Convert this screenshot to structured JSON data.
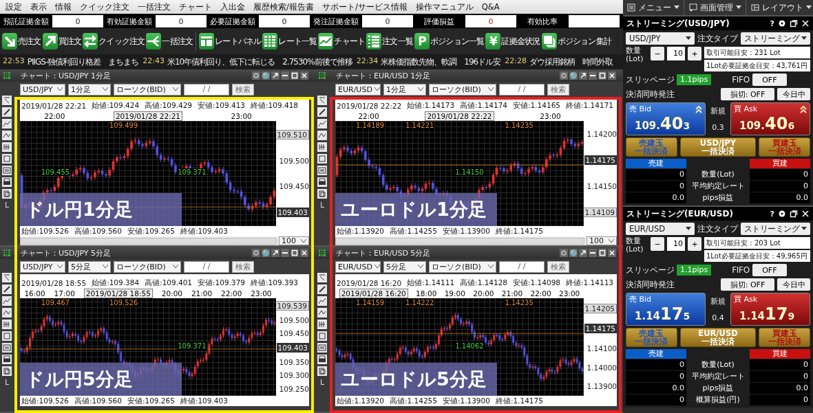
{
  "menu_bar": {
    "items": [
      "設定",
      "表示",
      "情報",
      "クイック注文",
      "一括注文",
      "チャート",
      "入出金",
      "履歴検索/報告書",
      "サポート/サービス情報",
      "操作マニュアル",
      "Q&A"
    ]
  },
  "top_right_buttons": [
    {
      "label": "メニュー"
    },
    {
      "label": "画面管理"
    },
    {
      "label": "レイアウト"
    }
  ],
  "account_summary": [
    {
      "label": "預託証拠金額",
      "value": "0"
    },
    {
      "label": "有効証拠金額",
      "value": "0"
    },
    {
      "label": "必要証拠金額",
      "value": "0"
    },
    {
      "label": "発注証拠金額",
      "value": "0"
    },
    {
      "label": "評価損益",
      "value": "0"
    },
    {
      "label": "有効比率"
    }
  ],
  "toolbar": [
    {
      "label": "売注文"
    },
    {
      "label": "買注文"
    },
    {
      "label": "クイック注文"
    },
    {
      "label": "一括注文"
    },
    {
      "label": "レートパネル"
    },
    {
      "label": "レート一覧"
    },
    {
      "label": "チャート"
    },
    {
      "label": "注文一覧"
    },
    {
      "label": "ポジション一覧",
      "glyph": "P"
    },
    {
      "label": "証拠金状況",
      "glyph": "¥"
    },
    {
      "label": "ポジション集計"
    }
  ],
  "news": [
    {
      "time": "22:53",
      "text": "PIIGS-独債利回り格差　まちまち"
    },
    {
      "time": "22:43",
      "text": "米10年債利回り、低下に転じる　2.7530%前後で推移"
    },
    {
      "time": "22:34",
      "text": "米株価指数先物、軟調　196ドル安"
    },
    {
      "time": "22:28",
      "text": "ダウ採用銘柄　時間外取"
    }
  ],
  "chart_columns": [
    {
      "color": "#ffee00",
      "charts": [
        {
          "title": "チャート：USD/JPY 1分足",
          "pair": "USD/JPY",
          "timeframe": "1分足",
          "style": "ローソク(BID)",
          "date": "/ /",
          "search": "検索",
          "info": [
            "2019/01/28 22:21",
            "始値:109.424",
            "高値:109.429",
            "安値:109.413",
            "終値:109.418"
          ],
          "time_axis": [
            {
              "label": "22:00",
              "kind": "tick"
            },
            {
              "label": "2019/01/28 22:21",
              "kind": "cursor"
            },
            {
              "label": "23:00",
              "kind": "tick"
            }
          ],
          "price_axis": [
            {
              "label": "109.510",
              "kind": "marker"
            },
            {
              "label": "109.500",
              "kind": "tick"
            },
            {
              "label": "109.450",
              "kind": "tick"
            },
            {
              "label": "109.403",
              "kind": "current"
            }
          ],
          "extremes": [
            {
              "label": "109.455",
              "kind": "low"
            },
            {
              "label": "109.499",
              "kind": "high"
            },
            {
              "label": "109.371",
              "kind": "low"
            }
          ],
          "caption": "ドル円1分足",
          "summary": [
            "始値:109.526",
            "高値:109.560",
            "安値:109.265",
            "終値:109.403"
          ],
          "zoom": "100",
          "tool_label": "L"
        },
        {
          "title": "チャート：USD/JPY 5分足",
          "pair": "USD/JPY",
          "timeframe": "5分足",
          "style": "ローソク(BID)",
          "date": "/ /",
          "search": "検索",
          "info": [
            "2019/01/28 18:55",
            "始値:109.384",
            "高値:109.401",
            "安値:109.379",
            "終値:109.393"
          ],
          "time_axis": [
            {
              "label": "16:00",
              "kind": "tick"
            },
            {
              "label": "17:00",
              "kind": "tick"
            },
            {
              "label": "2019/01/28 18:55",
              "kind": "cursor"
            },
            {
              "label": "20:00",
              "kind": "tick"
            },
            {
              "label": "21:00",
              "kind": "tick"
            },
            {
              "label": "22:00",
              "kind": "tick"
            },
            {
              "label": "23:00",
              "kind": "tick"
            }
          ],
          "price_axis": [
            {
              "label": "109.539",
              "kind": "marker"
            },
            {
              "label": "109.500",
              "kind": "tick"
            },
            {
              "label": "109.450",
              "kind": "tick"
            },
            {
              "label": "109.403",
              "kind": "current"
            },
            {
              "label": "109.350",
              "kind": "tick"
            },
            {
              "label": "109.300",
              "kind": "tick"
            },
            {
              "label": "109.250",
              "kind": "tick"
            }
          ],
          "extremes": [
            {
              "label": "109.467",
              "kind": "high"
            },
            {
              "label": "109.526",
              "kind": "high"
            },
            {
              "label": "109.371",
              "kind": "low"
            }
          ],
          "caption": "ドル円5分足",
          "summary": [
            "始値:109.526",
            "高値:109.560",
            "安値:109.265",
            "終値:109.403"
          ],
          "tool_label": "L"
        }
      ]
    },
    {
      "color": "#e82020",
      "charts": [
        {
          "title": "チャート：EUR/USD 1分足",
          "pair": "EUR/USD",
          "timeframe": "1分足",
          "style": "ローソク(BID)",
          "date": "/ /",
          "search": "検索",
          "info": [
            "2019/01/28 22:22",
            "始値:1.14173",
            "高値:1.14174",
            "安値:1.14165",
            "終値:1.14171"
          ],
          "time_axis": [
            {
              "label": "22:00",
              "kind": "tick"
            },
            {
              "label": "2019/01/28 22:22",
              "kind": "cursor"
            },
            {
              "label": "23:00",
              "kind": "tick"
            }
          ],
          "price_axis": [
            {
              "label": "1.14200",
              "kind": "tick"
            },
            {
              "label": "1.14175",
              "kind": "current"
            },
            {
              "label": "1.14150",
              "kind": "tick"
            },
            {
              "label": "1.14109",
              "kind": "marker"
            }
          ],
          "extremes": [
            {
              "label": "1.14189",
              "kind": "high"
            },
            {
              "label": "1.14221",
              "kind": "high"
            },
            {
              "label": "1.14150",
              "kind": "low"
            },
            {
              "label": "1.14235",
              "kind": "high"
            }
          ],
          "caption": "ユーロドル1分足",
          "summary": [
            "始値:1.13920",
            "高値:1.14255",
            "安値:1.13900",
            "終値:1.14175"
          ],
          "zoom": "100",
          "tool_label": "L"
        },
        {
          "title": "チャート：EUR/USD 5分足",
          "pair": "EUR/USD",
          "timeframe": "5分足",
          "style": "ローソク(BID)",
          "date": "/ /",
          "search": "検索",
          "info": [
            "2019/01/28 16:20",
            "始値:1.14111",
            "高値:1.14128",
            "安値:1.14098",
            "終値:1.14113"
          ],
          "time_axis": [
            {
              "label": "2019/01/28 16:20",
              "kind": "cursor"
            },
            {
              "label": "18:00",
              "kind": "tick"
            },
            {
              "label": "19:00",
              "kind": "tick"
            },
            {
              "label": "20:00",
              "kind": "tick"
            },
            {
              "label": "21:00",
              "kind": "tick"
            },
            {
              "label": "22:00",
              "kind": "tick"
            },
            {
              "label": "23:00",
              "kind": "tick"
            }
          ],
          "price_axis": [
            {
              "label": "1.14205",
              "kind": "marker"
            },
            {
              "label": "1.14175",
              "kind": "current"
            },
            {
              "label": "1.14100",
              "kind": "tick"
            },
            {
              "label": "1.14000",
              "kind": "tick"
            },
            {
              "label": "1.13900",
              "kind": "tick"
            }
          ],
          "extremes": [
            {
              "label": "1.14159",
              "kind": "high"
            },
            {
              "label": "1.14222",
              "kind": "high"
            },
            {
              "label": "1.14062",
              "kind": "low"
            },
            {
              "label": "1.14235",
              "kind": "high"
            }
          ],
          "caption": "ユーロドル5分足",
          "summary": [
            "始値:1.13920",
            "高値:1.14255",
            "安値:1.13900",
            "終値:1.14175"
          ],
          "tool_label": "L"
        }
      ]
    }
  ],
  "streaming_panels": [
    {
      "title": "ストリーミング(USD/JPY)",
      "help": "?",
      "pair": "USD/JPY",
      "order_type_label": "注文タイプ",
      "order_type": "ストリーミング",
      "qty_label": [
        "数量",
        "(Lot)"
      ],
      "minus": "−",
      "qty": "10",
      "plus": "+",
      "tradable": "取引可能目安：231 Lot",
      "margin": "1Lot必要証拠金目安：43,761円",
      "slippage_label": "スリッページ",
      "slippage": "1.1pips",
      "fifo_label": "FIFO",
      "fifo": "OFF",
      "settle_label": "決済同時発注",
      "stop": "損切: OFF",
      "period": "今日中",
      "bid": {
        "label": "売 Bid",
        "head": "109.",
        "big": "40",
        "tail": "3",
        "rising": true
      },
      "spread_label": "新規",
      "spread": "0.3",
      "ask": {
        "label": "買 Ask",
        "head": "109.",
        "big": "40",
        "tail": "6",
        "rising": true
      },
      "bulk_buttons": [
        {
          "lines": [
            "売建玉",
            "一括決済"
          ],
          "kind": "sell"
        },
        {
          "lines": [
            "USD/JPY",
            "一括決済"
          ],
          "kind": "all"
        },
        {
          "lines": [
            "買建玉",
            "一括決済"
          ],
          "kind": "buy"
        }
      ],
      "sell_header": "売建",
      "buy_header": "買建",
      "rows": [
        {
          "sell": "0",
          "label": "数量(Lot)",
          "buy": "0"
        },
        {
          "sell": "0",
          "label": "平均約定レート",
          "buy": "0"
        },
        {
          "sell": "0.0",
          "label": "pips損益",
          "buy": "0.0"
        }
      ]
    },
    {
      "title": "ストリーミング(EUR/USD)",
      "help": "?",
      "pair": "EUR/USD",
      "order_type_label": "注文タイプ",
      "order_type": "ストリーミング",
      "qty_label": [
        "数量",
        "(Lot)"
      ],
      "minus": "−",
      "qty": "10",
      "plus": "+",
      "tradable": "取引可能目安：203 Lot",
      "margin": "1Lot必要証拠金目安：49,965円",
      "slippage_label": "スリッページ",
      "slippage": "1.1pips",
      "fifo_label": "FIFO",
      "fifo": "OFF",
      "settle_label": "決済同時発注",
      "stop": "損切: OFF",
      "period": "今日中",
      "bid": {
        "label": "売 Bid",
        "head": "1.14",
        "big": "17",
        "tail": "5",
        "rising": false
      },
      "spread_label": "新規",
      "spread": "0.4",
      "ask": {
        "label": "買 Ask",
        "head": "1.14",
        "big": "17",
        "tail": "9",
        "rising": false
      },
      "bulk_buttons": [
        {
          "lines": [
            "売建玉",
            "一括決済"
          ],
          "kind": "sell"
        },
        {
          "lines": [
            "EUR/USD",
            "一括決済"
          ],
          "kind": "all"
        },
        {
          "lines": [
            "買建玉",
            "一括決済"
          ],
          "kind": "buy"
        }
      ],
      "sell_header": "売建",
      "buy_header": "買建",
      "rows": [
        {
          "sell": "0",
          "label": "数量(Lot)",
          "buy": "0"
        },
        {
          "sell": "0",
          "label": "平均約定レート",
          "buy": "0"
        },
        {
          "sell": "0.0",
          "label": "pips損益",
          "buy": "0.0"
        },
        {
          "sell": "0",
          "label": "概算損益(円)",
          "buy": "0"
        }
      ]
    }
  ]
}
